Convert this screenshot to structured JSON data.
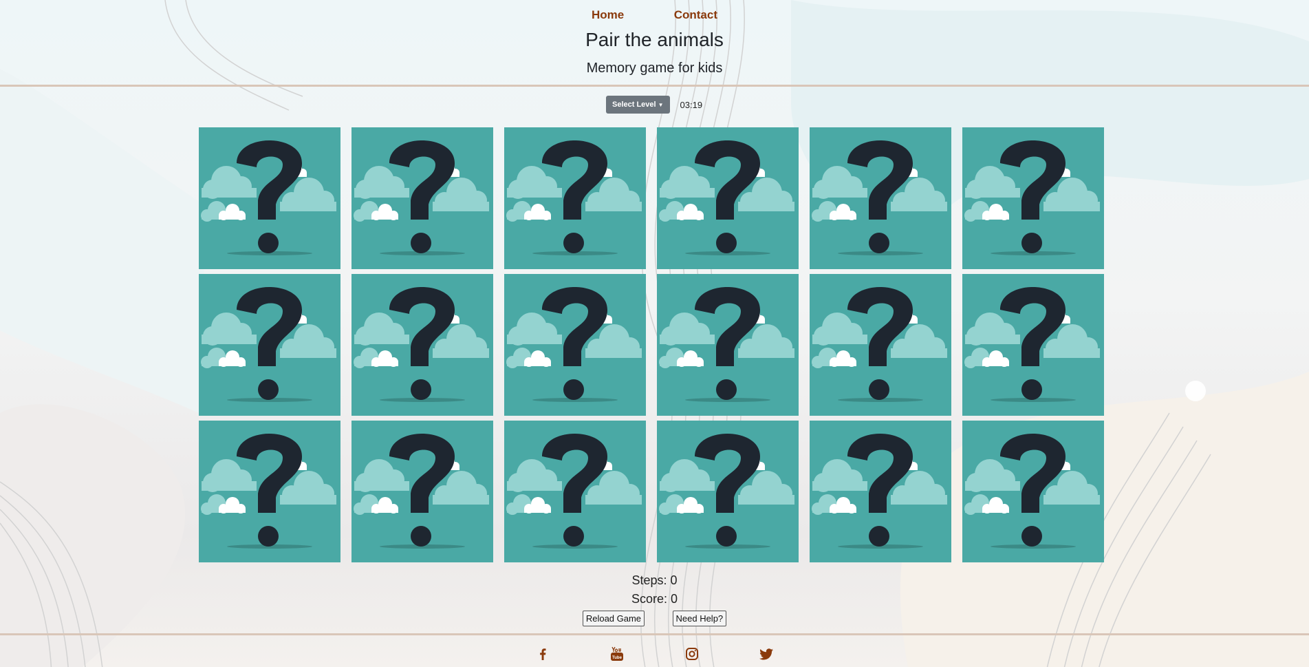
{
  "nav": {
    "home": "Home",
    "contact": "Contact"
  },
  "header": {
    "title": "Pair the animals",
    "subtitle": "Memory game for kids"
  },
  "controls": {
    "level_label": "Select Level",
    "timer": "03:19"
  },
  "board": {
    "rows": 3,
    "columns": 6,
    "card_face": "question-mark-icon"
  },
  "stats": {
    "steps": "Steps: 0",
    "score": "Score: 0"
  },
  "actions": {
    "reload": "Reload Game",
    "help": "Need Help?"
  },
  "social": [
    "facebook-icon",
    "youtube-icon",
    "instagram-icon",
    "twitter-icon"
  ],
  "colors": {
    "accent": "#8a3a0c",
    "card": "#4aa9a5",
    "question": "#1e2630",
    "cloud_light": "#94d3d0",
    "level_button": "#6c757d"
  }
}
